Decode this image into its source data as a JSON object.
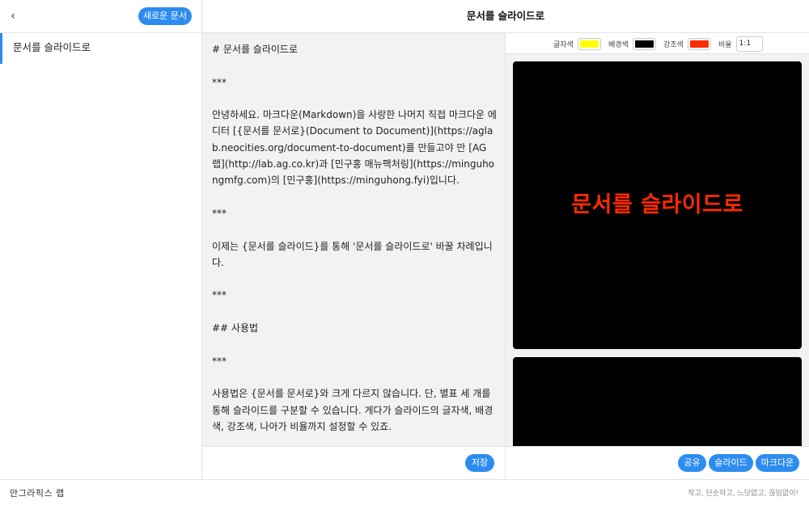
{
  "header": {
    "back_icon": "chevron-left-icon",
    "back_glyph": "‹",
    "new_doc_label": "새로운 문서",
    "title": "문서를 슬라이드로"
  },
  "sidebar": {
    "items": [
      {
        "label": "문서를 슬라이드로",
        "selected": true
      }
    ]
  },
  "editor": {
    "content": "# 문서를 슬라이드로\n\n***\n\n안녕하세요. 마크다운(Markdown)을 사랑한 나머지 직접 마크다운 에디터 [{문서를 문서로}(Document to Document)](https://aglab.neocities.org/document-to-document)를 만들고야 만 [AG 랩](http://lab.ag.co.kr)과 [민구홍 매뉴팩처링](https://minguhongmfg.com)의 [민구홍](https://minguhong.fyi)입니다.\n\n***\n\n이제는 {문서를 슬라이드}를 통해 '문서를 슬라이드로' 바꿀 차례입니다.\n\n***\n\n## 사용법\n\n***\n\n사용법은 {문서를 문서로}와 크게 다르지 않습니다. 단, 별표 세 개를 통해 슬라이드를 구분할 수 있습니다. 게다가 슬라이드의 글자색, 배경색, 강조색, 나아가 비율까지 설정할 수 있죠.",
    "save_label": "저장"
  },
  "preview": {
    "controls": {
      "text_color_label": "글자색",
      "text_color": "#ffff00",
      "bg_color_label": "배경색",
      "bg_color": "#000000",
      "accent_color_label": "강조색",
      "accent_color": "#ff2a00",
      "ratio_label": "비율",
      "ratio_value": "1:1"
    },
    "slides": [
      {
        "title": "문서를 슬라이드로"
      }
    ],
    "buttons": {
      "share": "공유",
      "slide": "슬라이드",
      "markdown": "마크다운"
    }
  },
  "footer": {
    "brand": "안그라픽스 랩",
    "tagline": "작고, 단순하고, 느닷없고, 끊임없이!"
  }
}
